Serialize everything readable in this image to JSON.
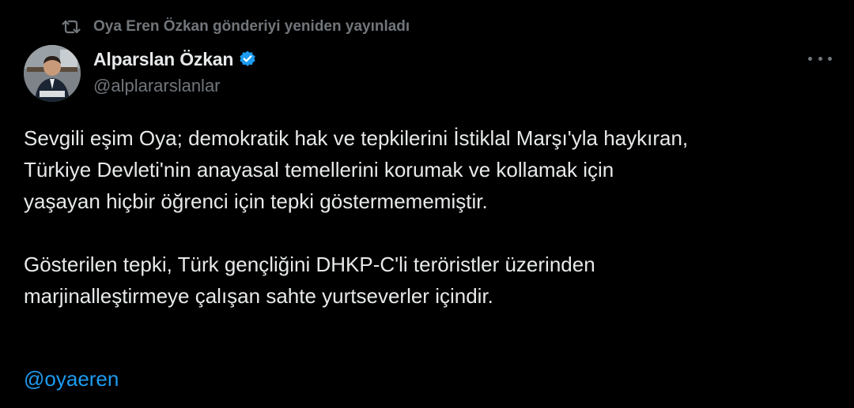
{
  "repost": {
    "icon": "repost-icon",
    "text": "Oya Eren Özkan gönderiyi yeniden yayınladı"
  },
  "author": {
    "display_name": "Alparslan Özkan",
    "handle": "@alplararslanlar",
    "verified_icon": "verified-badge-icon",
    "verified_color": "#1d9bf0"
  },
  "menu": {
    "icon": "more-options-icon"
  },
  "tweet": {
    "paragraphs": [
      {
        "lines": [
          "Sevgili eşim Oya; demokratik hak ve tepkilerini İstiklal Marşı'yla haykıran,",
          "Türkiye Devleti'nin anayasal temellerini korumak ve kollamak için",
          "yaşayan hiçbir öğrenci için tepki göstermememiştir."
        ]
      },
      {
        "lines": [
          "Gösterilen tepki, Türk gençliğini DHKP-C'li teröristler üzerinden",
          "marjinalleştirmeye çalışan sahte yurtseverler içindir."
        ]
      }
    ],
    "mention": "@oyaeren"
  },
  "colors": {
    "background": "#000000",
    "text_primary": "#e7e9ea",
    "text_secondary": "#71767b",
    "link": "#1d9bf0"
  }
}
